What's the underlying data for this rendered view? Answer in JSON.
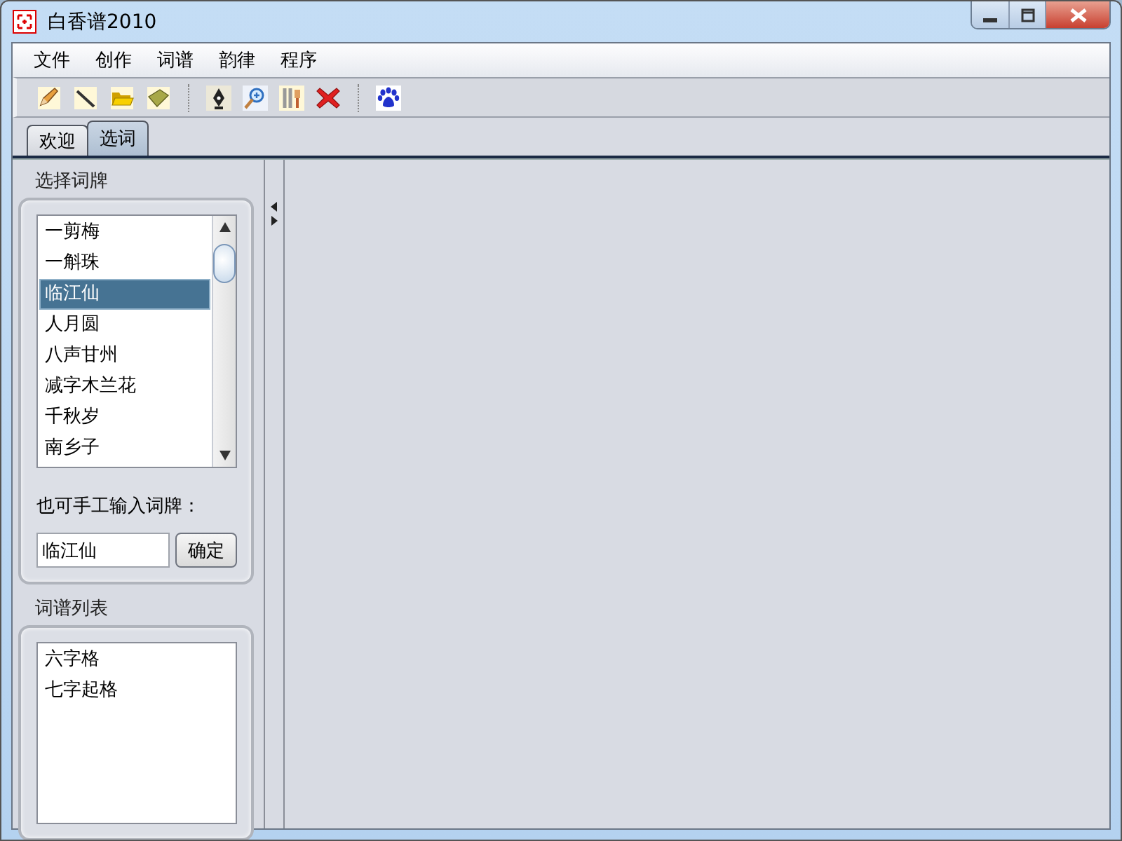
{
  "window": {
    "title": "白香谱2010"
  },
  "menu": [
    "文件",
    "创作",
    "词谱",
    "韵律",
    "程序"
  ],
  "tabs": [
    {
      "label": "欢迎",
      "selected": false
    },
    {
      "label": "选词",
      "selected": true
    }
  ],
  "cipai": {
    "label": "选择词牌",
    "items": [
      {
        "text": "一剪梅",
        "selected": false
      },
      {
        "text": "一斛珠",
        "selected": false
      },
      {
        "text": "临江仙",
        "selected": true
      },
      {
        "text": "人月圆",
        "selected": false
      },
      {
        "text": "八声甘州",
        "selected": false
      },
      {
        "text": "减字木兰花",
        "selected": false
      },
      {
        "text": "千秋岁",
        "selected": false
      },
      {
        "text": "南乡子",
        "selected": false
      }
    ],
    "input_label": "也可手工输入词牌：",
    "input_value": "临江仙",
    "button": "确定"
  },
  "cipu": {
    "label": "词谱列表",
    "items": [
      "六字格",
      "七字起格"
    ]
  }
}
